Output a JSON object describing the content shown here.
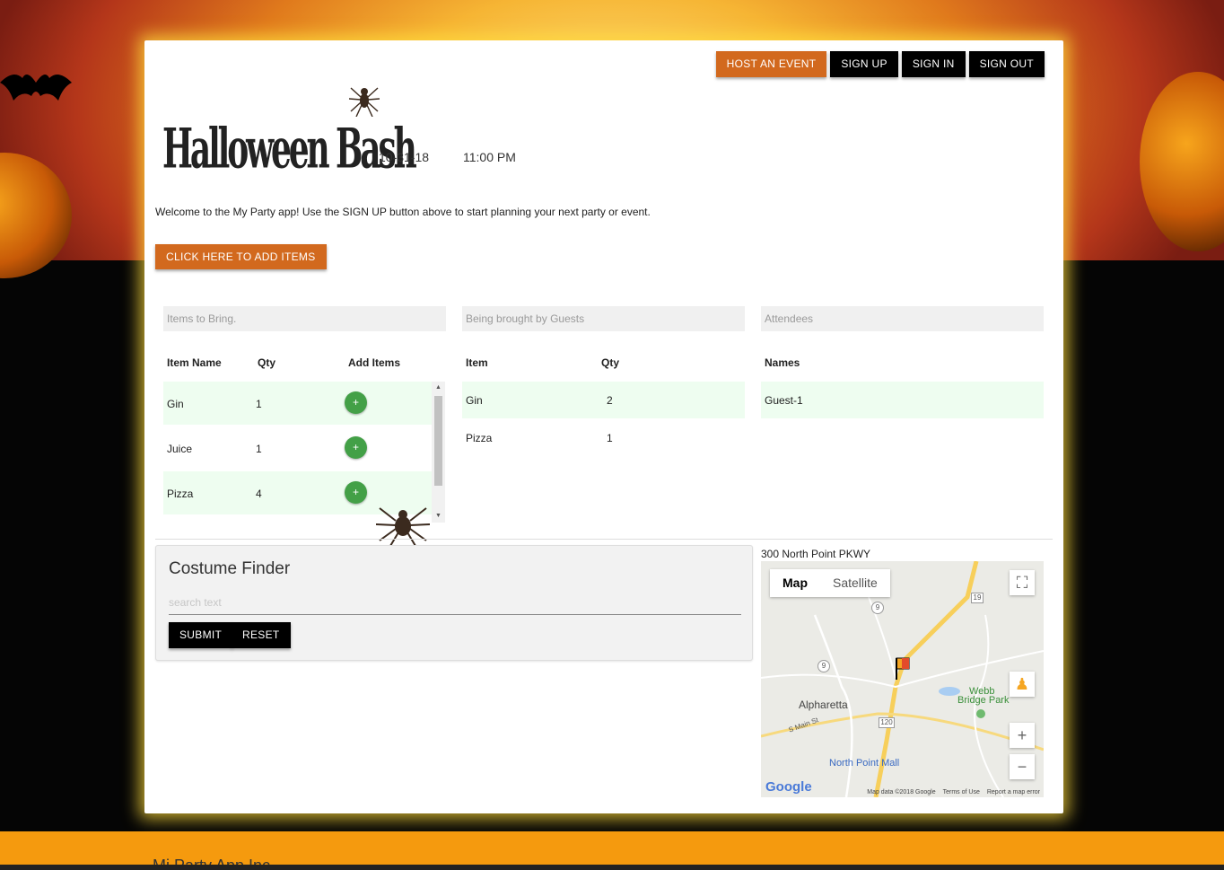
{
  "nav": {
    "host_label": "HOST AN EVENT",
    "signup_label": "SIGN UP",
    "signin_label": "SIGN IN",
    "signout_label": "SIGN OUT"
  },
  "event": {
    "title": "Halloween Bash",
    "date": "10-31-18",
    "time": "11:00 PM"
  },
  "welcome_text": "Welcome to the My Party app! Use the SIGN UP button above to start planning your next party or event.",
  "add_items_label": "CLICK HERE TO ADD ITEMS",
  "items_to_bring": {
    "header": "Items to Bring.",
    "columns": [
      "Item Name",
      "Qty",
      "Add Items"
    ],
    "rows": [
      {
        "name": "Gin",
        "qty": "1",
        "add": "+"
      },
      {
        "name": "Juice",
        "qty": "1",
        "add": "+"
      },
      {
        "name": "Pizza",
        "qty": "4",
        "add": "+"
      }
    ]
  },
  "brought_by_guests": {
    "header": "Being brought by Guests",
    "columns": [
      "Item",
      "Qty"
    ],
    "rows": [
      {
        "name": "Gin",
        "qty": "2"
      },
      {
        "name": "Pizza",
        "qty": "1"
      }
    ]
  },
  "attendees": {
    "header": "Attendees",
    "columns": [
      "Names"
    ],
    "rows": [
      {
        "name": "Guest-1"
      }
    ]
  },
  "costume_finder": {
    "title": "Costume Finder",
    "placeholder": "search text",
    "value": "",
    "submit_label": "SUBMIT",
    "reset_label": "RESET"
  },
  "map": {
    "address": "300 North Point PKWY",
    "type_map": "Map",
    "type_satellite": "Satellite",
    "labels": {
      "alpharetta": "Alpharetta",
      "webb": "Webb",
      "bridge_park": "Bridge Park",
      "north_point_mall": "North Point Mall",
      "s_main": "S Main St"
    },
    "shields": [
      "9",
      "9",
      "19",
      "120"
    ],
    "zoom_in": "+",
    "zoom_out": "−",
    "google": "Google",
    "footer": [
      "Map data ©2018 Google",
      "Terms of Use",
      "Report a map error"
    ]
  },
  "footer": {
    "text": "Mi Party App Inc"
  },
  "colors": {
    "accent_orange": "#d2691e",
    "button_black": "#000000",
    "row_highlight": "#eefdf0",
    "add_green": "#43a047",
    "footer_orange": "#f59a0e"
  }
}
